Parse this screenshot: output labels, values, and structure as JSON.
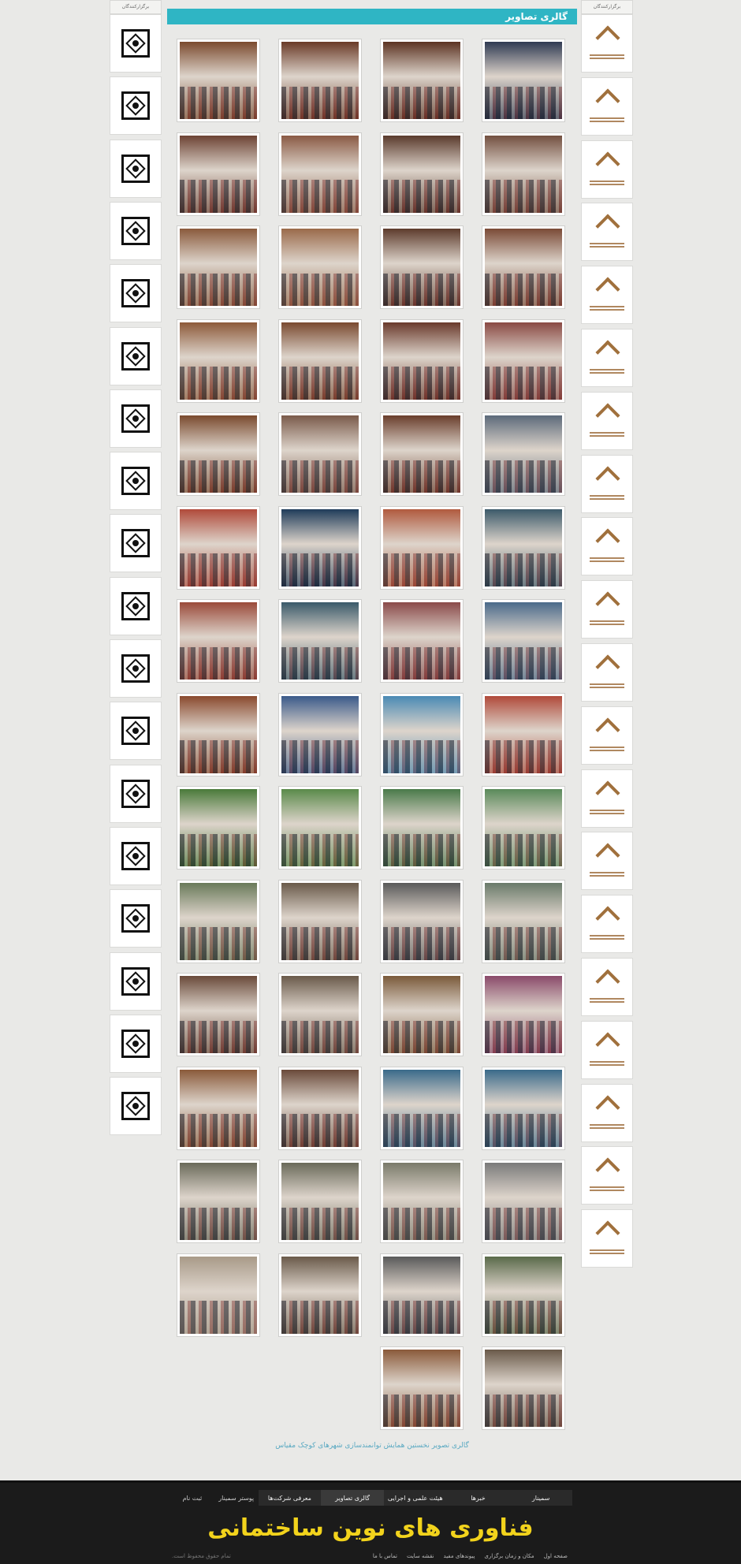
{
  "gallery": {
    "title": "گالری تصاویر",
    "caption": "گالری تصویر نخستین همایش توانمندسازی شهرهای کوچک مقیاس",
    "photos": [
      [
        "#7b4a2e",
        "#6a3a27",
        "#5c3322",
        "#2f3a52"
      ],
      [
        "#6d4334",
        "#8a5a44",
        "#5a3a2c",
        "#735040"
      ],
      [
        "#8a5a3c",
        "#9a6a4a",
        "#5d3b2c",
        "#7a4a36"
      ],
      [
        "#8d5a3a",
        "#7a4a30",
        "#6a3a2c",
        "#8a4a44"
      ],
      [
        "#7a4a2e",
        "#7a5a4a",
        "#6a3e2c",
        "#5c6a7a"
      ],
      [
        "#b04a3a",
        "#1f3c5a",
        "#b05a3e",
        "#3c5a6a"
      ],
      [
        "#9a4a3a",
        "#3a5a6a",
        "#8a4a4a",
        "#4a6a8a"
      ],
      [
        "#8a4a2e",
        "#3a5a8a",
        "#4a8ab4",
        "#b04a3a"
      ],
      [
        "#4a7a3a",
        "#5a8a4a",
        "#4a7a4a",
        "#5a8a5a"
      ],
      [
        "#6a7a5a",
        "#6a5a4a",
        "#5a5a5a",
        "#6a7a6a"
      ],
      [
        "#6a4a3a",
        "#6a5a4a",
        "#7a5a3a",
        "#8a4a6a"
      ],
      [
        "#8a5a3a",
        "#6a4a3a",
        "#3a6a8a",
        "#3a6a8a"
      ],
      [
        "#6a6a5a",
        "#6a6a5a",
        "#7a7a6a",
        "#7a7a7a"
      ],
      [
        "#a89a88",
        "#6a5a4a",
        "#5a5a5a",
        "#5a6a4a"
      ],
      [
        null,
        null,
        "#8a5a3a",
        "#6a5a4a"
      ]
    ]
  },
  "sidebar_left": {
    "header": "برگزارکنندگان",
    "logo_count": 18
  },
  "sidebar_right": {
    "header": "برگزارکنندگان",
    "logo_count": 20
  },
  "footer": {
    "nav": [
      "سمینار",
      "خبرها",
      "هیئت علمی و اجرایی",
      "گالری تصاویر",
      "معرفی شرکت‌ها",
      "پوستر سمینار",
      "ثبت نام"
    ],
    "brand": "فناوری های نوین ساختمانی",
    "links": [
      "صفحه اول",
      "مکان و زمان برگزاری",
      "پیوندهای مفید",
      "نقشه سایت",
      "تماس با ما"
    ],
    "copyright": "تمام حقوق محفوظ است."
  }
}
